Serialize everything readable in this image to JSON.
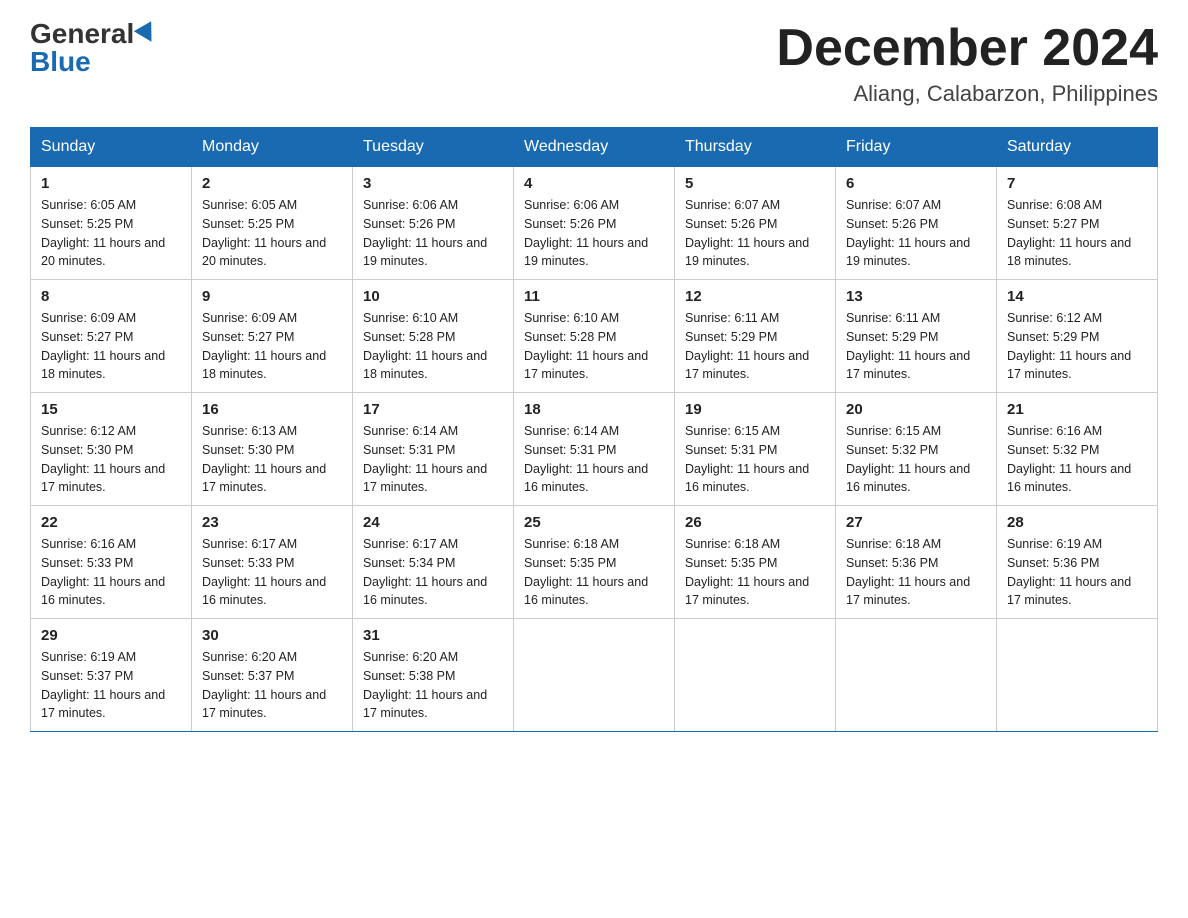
{
  "header": {
    "logo_general": "General",
    "logo_blue": "Blue",
    "month_title": "December 2024",
    "location": "Aliang, Calabarzon, Philippines"
  },
  "weekdays": [
    "Sunday",
    "Monday",
    "Tuesday",
    "Wednesday",
    "Thursday",
    "Friday",
    "Saturday"
  ],
  "weeks": [
    [
      {
        "day": "1",
        "sunrise": "6:05 AM",
        "sunset": "5:25 PM",
        "daylight": "11 hours and 20 minutes."
      },
      {
        "day": "2",
        "sunrise": "6:05 AM",
        "sunset": "5:25 PM",
        "daylight": "11 hours and 20 minutes."
      },
      {
        "day": "3",
        "sunrise": "6:06 AM",
        "sunset": "5:26 PM",
        "daylight": "11 hours and 19 minutes."
      },
      {
        "day": "4",
        "sunrise": "6:06 AM",
        "sunset": "5:26 PM",
        "daylight": "11 hours and 19 minutes."
      },
      {
        "day": "5",
        "sunrise": "6:07 AM",
        "sunset": "5:26 PM",
        "daylight": "11 hours and 19 minutes."
      },
      {
        "day": "6",
        "sunrise": "6:07 AM",
        "sunset": "5:26 PM",
        "daylight": "11 hours and 19 minutes."
      },
      {
        "day": "7",
        "sunrise": "6:08 AM",
        "sunset": "5:27 PM",
        "daylight": "11 hours and 18 minutes."
      }
    ],
    [
      {
        "day": "8",
        "sunrise": "6:09 AM",
        "sunset": "5:27 PM",
        "daylight": "11 hours and 18 minutes."
      },
      {
        "day": "9",
        "sunrise": "6:09 AM",
        "sunset": "5:27 PM",
        "daylight": "11 hours and 18 minutes."
      },
      {
        "day": "10",
        "sunrise": "6:10 AM",
        "sunset": "5:28 PM",
        "daylight": "11 hours and 18 minutes."
      },
      {
        "day": "11",
        "sunrise": "6:10 AM",
        "sunset": "5:28 PM",
        "daylight": "11 hours and 17 minutes."
      },
      {
        "day": "12",
        "sunrise": "6:11 AM",
        "sunset": "5:29 PM",
        "daylight": "11 hours and 17 minutes."
      },
      {
        "day": "13",
        "sunrise": "6:11 AM",
        "sunset": "5:29 PM",
        "daylight": "11 hours and 17 minutes."
      },
      {
        "day": "14",
        "sunrise": "6:12 AM",
        "sunset": "5:29 PM",
        "daylight": "11 hours and 17 minutes."
      }
    ],
    [
      {
        "day": "15",
        "sunrise": "6:12 AM",
        "sunset": "5:30 PM",
        "daylight": "11 hours and 17 minutes."
      },
      {
        "day": "16",
        "sunrise": "6:13 AM",
        "sunset": "5:30 PM",
        "daylight": "11 hours and 17 minutes."
      },
      {
        "day": "17",
        "sunrise": "6:14 AM",
        "sunset": "5:31 PM",
        "daylight": "11 hours and 17 minutes."
      },
      {
        "day": "18",
        "sunrise": "6:14 AM",
        "sunset": "5:31 PM",
        "daylight": "11 hours and 16 minutes."
      },
      {
        "day": "19",
        "sunrise": "6:15 AM",
        "sunset": "5:31 PM",
        "daylight": "11 hours and 16 minutes."
      },
      {
        "day": "20",
        "sunrise": "6:15 AM",
        "sunset": "5:32 PM",
        "daylight": "11 hours and 16 minutes."
      },
      {
        "day": "21",
        "sunrise": "6:16 AM",
        "sunset": "5:32 PM",
        "daylight": "11 hours and 16 minutes."
      }
    ],
    [
      {
        "day": "22",
        "sunrise": "6:16 AM",
        "sunset": "5:33 PM",
        "daylight": "11 hours and 16 minutes."
      },
      {
        "day": "23",
        "sunrise": "6:17 AM",
        "sunset": "5:33 PM",
        "daylight": "11 hours and 16 minutes."
      },
      {
        "day": "24",
        "sunrise": "6:17 AM",
        "sunset": "5:34 PM",
        "daylight": "11 hours and 16 minutes."
      },
      {
        "day": "25",
        "sunrise": "6:18 AM",
        "sunset": "5:35 PM",
        "daylight": "11 hours and 16 minutes."
      },
      {
        "day": "26",
        "sunrise": "6:18 AM",
        "sunset": "5:35 PM",
        "daylight": "11 hours and 17 minutes."
      },
      {
        "day": "27",
        "sunrise": "6:18 AM",
        "sunset": "5:36 PM",
        "daylight": "11 hours and 17 minutes."
      },
      {
        "day": "28",
        "sunrise": "6:19 AM",
        "sunset": "5:36 PM",
        "daylight": "11 hours and 17 minutes."
      }
    ],
    [
      {
        "day": "29",
        "sunrise": "6:19 AM",
        "sunset": "5:37 PM",
        "daylight": "11 hours and 17 minutes."
      },
      {
        "day": "30",
        "sunrise": "6:20 AM",
        "sunset": "5:37 PM",
        "daylight": "11 hours and 17 minutes."
      },
      {
        "day": "31",
        "sunrise": "6:20 AM",
        "sunset": "5:38 PM",
        "daylight": "11 hours and 17 minutes."
      },
      null,
      null,
      null,
      null
    ]
  ],
  "labels": {
    "sunrise": "Sunrise:",
    "sunset": "Sunset:",
    "daylight": "Daylight:"
  }
}
